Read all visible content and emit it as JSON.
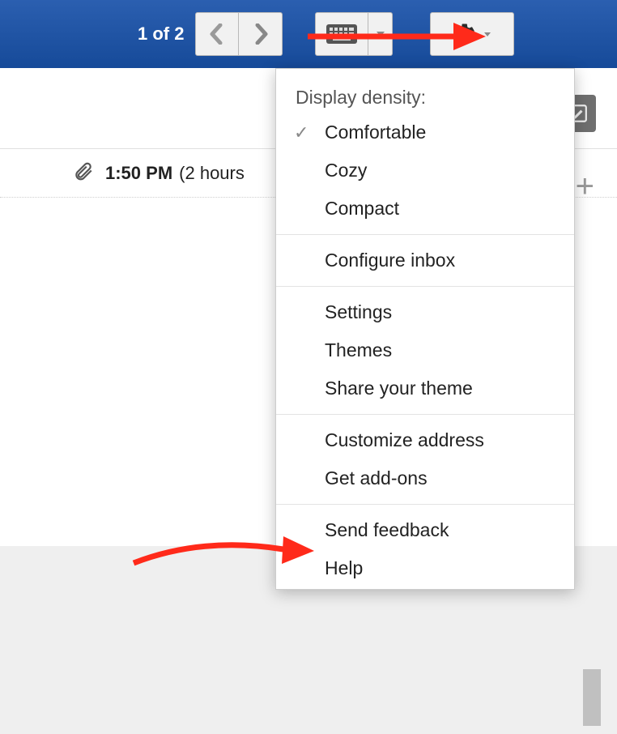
{
  "header": {
    "pager_text": "1 of 2"
  },
  "message": {
    "timestamp": "1:50 PM",
    "relative": "(2 hours"
  },
  "dropdown": {
    "density_label": "Display density:",
    "items": {
      "comfortable": "Comfortable",
      "cozy": "Cozy",
      "compact": "Compact",
      "configure_inbox": "Configure inbox",
      "settings": "Settings",
      "themes": "Themes",
      "share_theme": "Share your theme",
      "customize_address": "Customize address",
      "get_addons": "Get add-ons",
      "send_feedback": "Send feedback",
      "help": "Help"
    }
  }
}
